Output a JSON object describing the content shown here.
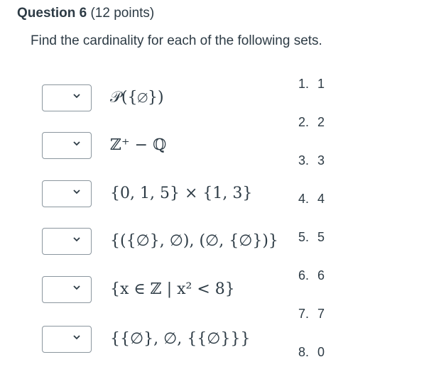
{
  "question": {
    "title": "Question 6",
    "points": "(12 points)",
    "prompt": "Find the cardinality for each of the following sets."
  },
  "items": [
    {
      "expression": "𝒫({∅})",
      "selected": ""
    },
    {
      "expression": "ℤ⁺ − ℚ",
      "selected": ""
    },
    {
      "expression": "{0, 1, 5} × {1, 3}",
      "selected": ""
    },
    {
      "expression": "{({∅}, ∅), (∅, {∅})}",
      "selected": ""
    },
    {
      "expression": "{x ∈ ℤ | x² < 8}",
      "selected": ""
    },
    {
      "expression": "{{∅}, ∅, {{∅}}}",
      "selected": ""
    }
  ],
  "answers": [
    {
      "num": "1.",
      "value": "1"
    },
    {
      "num": "2.",
      "value": "2"
    },
    {
      "num": "3.",
      "value": "3"
    },
    {
      "num": "4.",
      "value": "4"
    },
    {
      "num": "5.",
      "value": "5"
    },
    {
      "num": "6.",
      "value": "6"
    },
    {
      "num": "7.",
      "value": "7"
    },
    {
      "num": "8.",
      "value": "0"
    }
  ],
  "icons": {
    "dropdown": "chevron-down-icon"
  },
  "colors": {
    "text": "#2d3b45",
    "border": "#8b969e"
  }
}
